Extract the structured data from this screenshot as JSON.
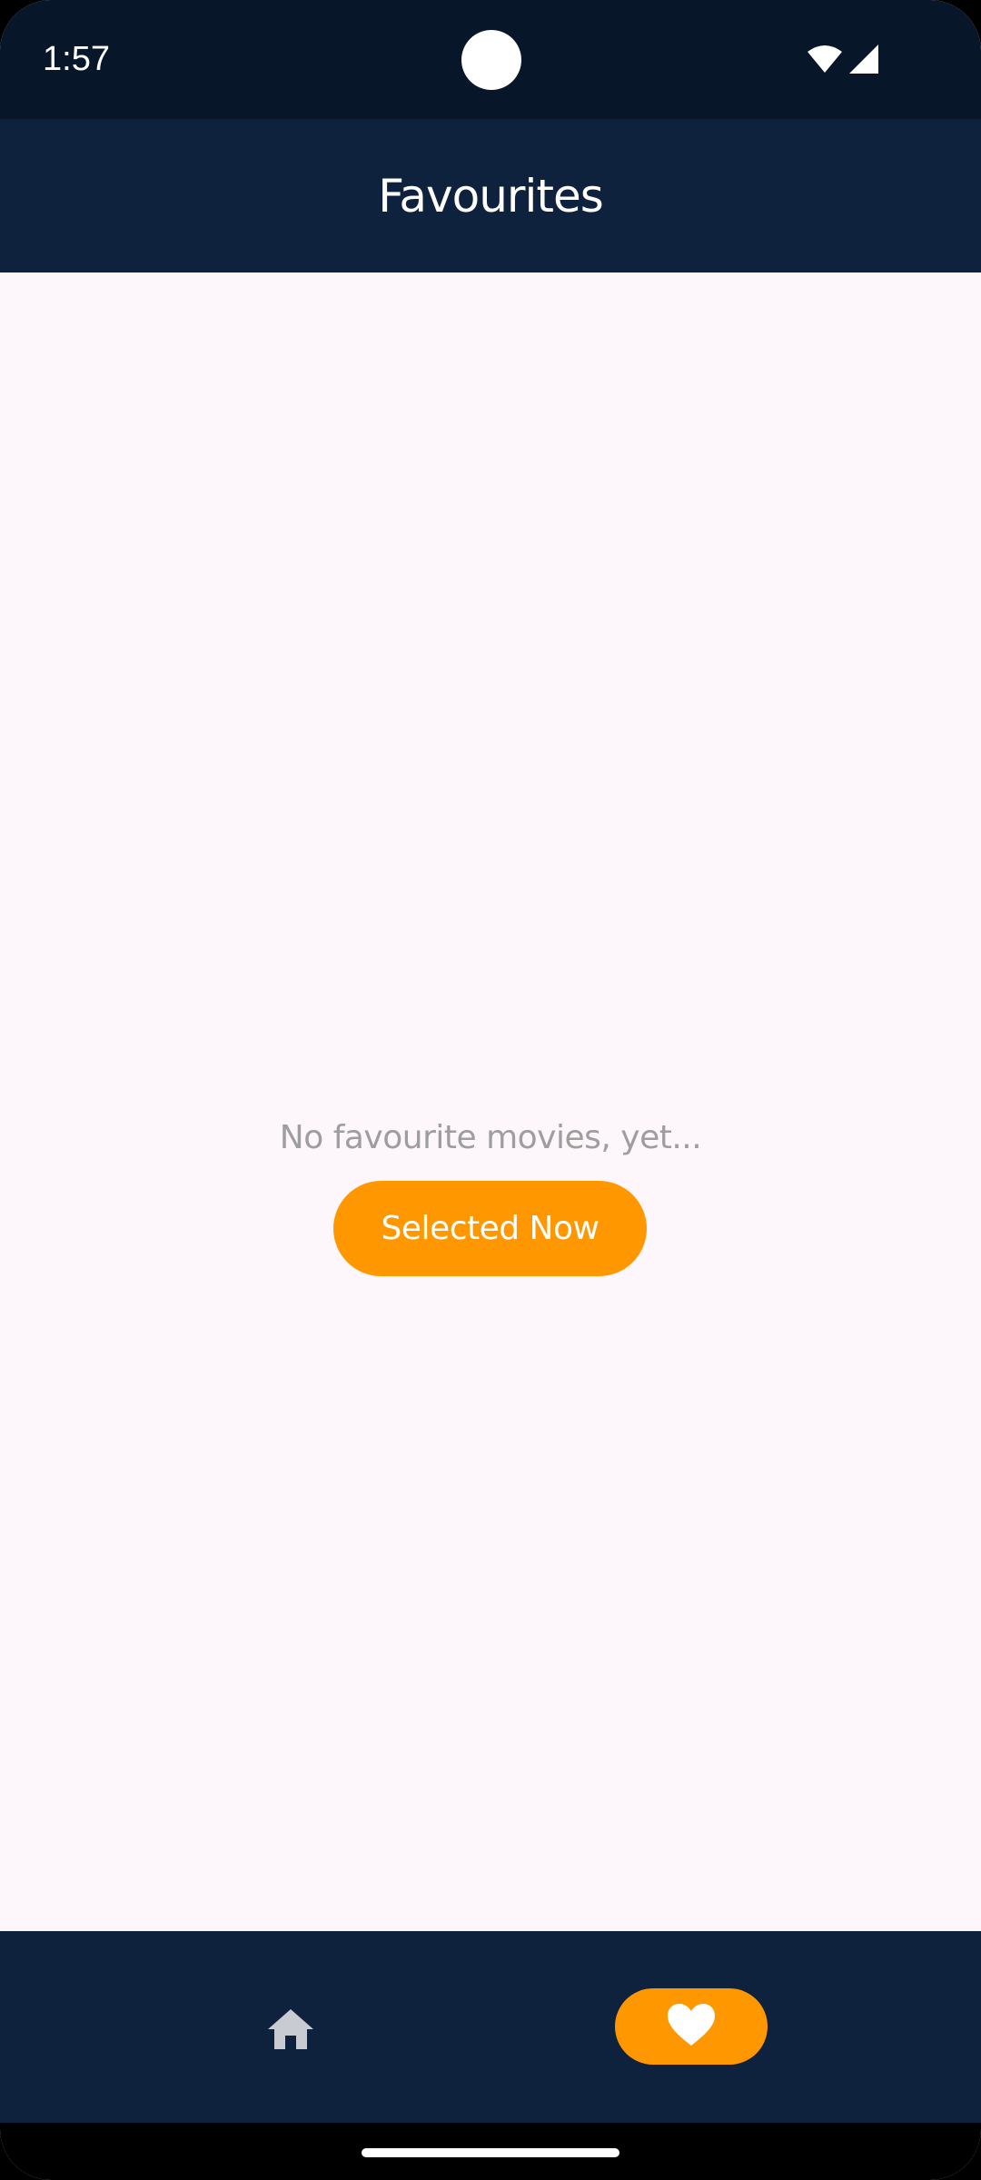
{
  "status_bar": {
    "time": "1:57",
    "icons": [
      "wifi-icon",
      "cellular-signal-icon"
    ]
  },
  "app_bar": {
    "title": "Favourites"
  },
  "main": {
    "empty_message": "No favourite movies, yet...",
    "action_button_label": "Selected Now"
  },
  "bottom_nav": {
    "items": [
      {
        "icon": "home-icon",
        "selected": false
      },
      {
        "icon": "heart-icon",
        "selected": true
      }
    ]
  },
  "colors": {
    "status_bar_bg": "#08162A",
    "app_bar_bg": "#0F223D",
    "content_bg": "#FDF6FB",
    "accent": "#FF9800",
    "muted_text": "#9E9E9E",
    "inactive_icon": "#C8CBD2"
  }
}
